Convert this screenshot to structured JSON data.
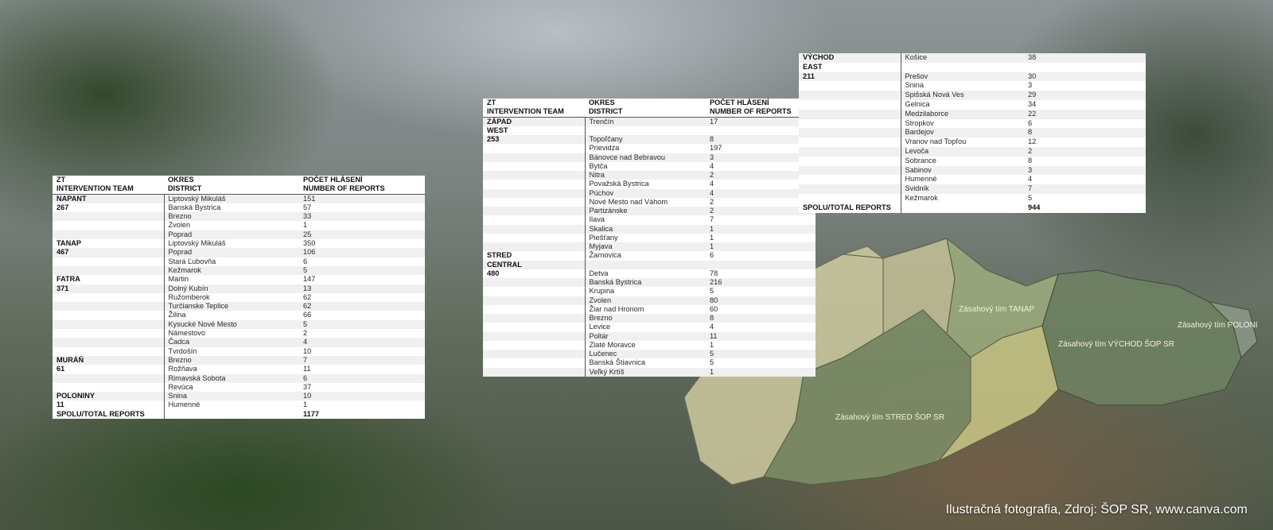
{
  "caption": "Ilustračná fotografia, Zdroj: ŠOP SR, www.canva.com",
  "map_labels": {
    "tanap": "Zásahový tím TANAP",
    "vychod": "Zásahový tím VÝCHOD ŠOP SR",
    "poloniny": "Zásahový tím POLONINY",
    "stred": "Zásahový tím STRED ŠOP SR"
  },
  "colors": {
    "map_light": "#d8d4a6",
    "map_yellow": "#d2cf8a",
    "map_green": "#8c9a72",
    "map_darkgreen": "#6f8262",
    "map_grey": "#8e9a8c"
  },
  "table1": {
    "header": {
      "col1_line1": "ZT",
      "col1_line2": "INTERVENTION TEAM",
      "col2_line1": "OKRES",
      "col2_line2": "DISTRICT",
      "col3_line1": "POČET HLÁSENÍ",
      "col3_line2": "NUMBER OF REPORTS"
    },
    "rows": [
      {
        "team": "NAPANT",
        "district": "Liptovský Mikuláš",
        "reports": "151"
      },
      {
        "team": "267",
        "district": "Banská Bystrica",
        "reports": "57"
      },
      {
        "team": "",
        "district": "Brezno",
        "reports": "33"
      },
      {
        "team": "",
        "district": "Zvolen",
        "reports": "1"
      },
      {
        "team": "",
        "district": "Poprad",
        "reports": "25"
      },
      {
        "team": "TANAP",
        "district": "Liptovský Mikuláš",
        "reports": "350"
      },
      {
        "team": "467",
        "district": "Poprad",
        "reports": "106"
      },
      {
        "team": "",
        "district": "Stará Ľubovňa",
        "reports": "6"
      },
      {
        "team": "",
        "district": "Kežmarok",
        "reports": "5"
      },
      {
        "team": "FATRA",
        "district": "Martin",
        "reports": "147"
      },
      {
        "team": "371",
        "district": "Dolný Kubín",
        "reports": "13"
      },
      {
        "team": "",
        "district": "Ružomberok",
        "reports": "62"
      },
      {
        "team": "",
        "district": "Turčianske Teplice",
        "reports": "62"
      },
      {
        "team": "",
        "district": "Žilina",
        "reports": "66"
      },
      {
        "team": "",
        "district": "Kysucké Nové Mesto",
        "reports": "5"
      },
      {
        "team": "",
        "district": "Námestovo",
        "reports": "2"
      },
      {
        "team": "",
        "district": "Čadca",
        "reports": "4"
      },
      {
        "team": "",
        "district": "Tvrdošín",
        "reports": "10"
      },
      {
        "team": "MURÁŇ",
        "district": "Brezno",
        "reports": "7"
      },
      {
        "team": "61",
        "district": "Rožňava",
        "reports": "11"
      },
      {
        "team": "",
        "district": "Rimavská Sobota",
        "reports": "6"
      },
      {
        "team": "",
        "district": "Revúca",
        "reports": "37"
      },
      {
        "team": "POLONINY",
        "district": "Snina",
        "reports": "10"
      },
      {
        "team": "11",
        "district": "Humenné",
        "reports": "1"
      }
    ],
    "total": {
      "label": "SPOLU/TOTAL REPORTS",
      "value": "1177"
    }
  },
  "table2": {
    "header": {
      "col1_line1": "ZT",
      "col1_line2": "INTERVENTION TEAM",
      "col2_line1": "OKRES",
      "col2_line2": "DISTRICT",
      "col3_line1": "POČET HLÁSENÍ",
      "col3_line2": "NUMBER OF REPORTS"
    },
    "rows": [
      {
        "team": "ZÁPAD",
        "district": "Trenčín",
        "reports": "17"
      },
      {
        "team": "WEST",
        "district": "",
        "reports": ""
      },
      {
        "team": "253",
        "district": "Topoľčany",
        "reports": "8"
      },
      {
        "team": "",
        "district": "Prievidza",
        "reports": "197"
      },
      {
        "team": "",
        "district": "Bánovce nad Bebravou",
        "reports": "3"
      },
      {
        "team": "",
        "district": "Bytča",
        "reports": "4"
      },
      {
        "team": "",
        "district": "Nitra",
        "reports": "2"
      },
      {
        "team": "",
        "district": "Považská Bystrica",
        "reports": "4"
      },
      {
        "team": "",
        "district": "Púchov",
        "reports": "4"
      },
      {
        "team": "",
        "district": "Nové Mesto nad Váhom",
        "reports": "2"
      },
      {
        "team": "",
        "district": "Partizánske",
        "reports": "2"
      },
      {
        "team": "",
        "district": "Ilava",
        "reports": "7"
      },
      {
        "team": "",
        "district": "Skalica",
        "reports": "1"
      },
      {
        "team": "",
        "district": "Piešťany",
        "reports": "1"
      },
      {
        "team": "",
        "district": "Myjava",
        "reports": "1"
      },
      {
        "team": "STRED",
        "district": "Žarnovica",
        "reports": "6"
      },
      {
        "team": "CENTRAL",
        "district": "",
        "reports": ""
      },
      {
        "team": "480",
        "district": "Detva",
        "reports": "78"
      },
      {
        "team": "",
        "district": "Banská Bystrica",
        "reports": "216"
      },
      {
        "team": "",
        "district": "Krupina",
        "reports": "5"
      },
      {
        "team": "",
        "district": "Zvolen",
        "reports": "80"
      },
      {
        "team": "",
        "district": "Žiar nad Hronom",
        "reports": "60"
      },
      {
        "team": "",
        "district": "Brezno",
        "reports": "8"
      },
      {
        "team": "",
        "district": "Levice",
        "reports": "4"
      },
      {
        "team": "",
        "district": "Poltár",
        "reports": "11"
      },
      {
        "team": "",
        "district": "Zlaté Moravce",
        "reports": "1"
      },
      {
        "team": "",
        "district": "Lučenec",
        "reports": "5"
      },
      {
        "team": "",
        "district": "Banská Štiavnica",
        "reports": "5"
      },
      {
        "team": "",
        "district": "Veľký Krtíš",
        "reports": "1"
      }
    ]
  },
  "table3": {
    "rows": [
      {
        "team": "VÝCHOD",
        "district": "Košice",
        "reports": "38"
      },
      {
        "team": "EAST",
        "district": "",
        "reports": ""
      },
      {
        "team": "211",
        "district": "Prešov",
        "reports": "30"
      },
      {
        "team": "",
        "district": "Snina",
        "reports": "3"
      },
      {
        "team": "",
        "district": "Spišská Nová Ves",
        "reports": "29"
      },
      {
        "team": "",
        "district": "Gelnica",
        "reports": "34"
      },
      {
        "team": "",
        "district": "Medzilaborce",
        "reports": "22"
      },
      {
        "team": "",
        "district": "Stropkov",
        "reports": "6"
      },
      {
        "team": "",
        "district": "Bardejov",
        "reports": "8"
      },
      {
        "team": "",
        "district": "Vranov nad Topľou",
        "reports": "12"
      },
      {
        "team": "",
        "district": "Levoča",
        "reports": "2"
      },
      {
        "team": "",
        "district": "Sobrance",
        "reports": "8"
      },
      {
        "team": "",
        "district": "Sabinov",
        "reports": "3"
      },
      {
        "team": "",
        "district": "Humenné",
        "reports": "4"
      },
      {
        "team": "",
        "district": "Svidník",
        "reports": "7"
      },
      {
        "team": "",
        "district": "Kežmarok",
        "reports": "5"
      }
    ],
    "total": {
      "label": "SPOLU/TOTAL REPORTS",
      "value": "944"
    }
  }
}
